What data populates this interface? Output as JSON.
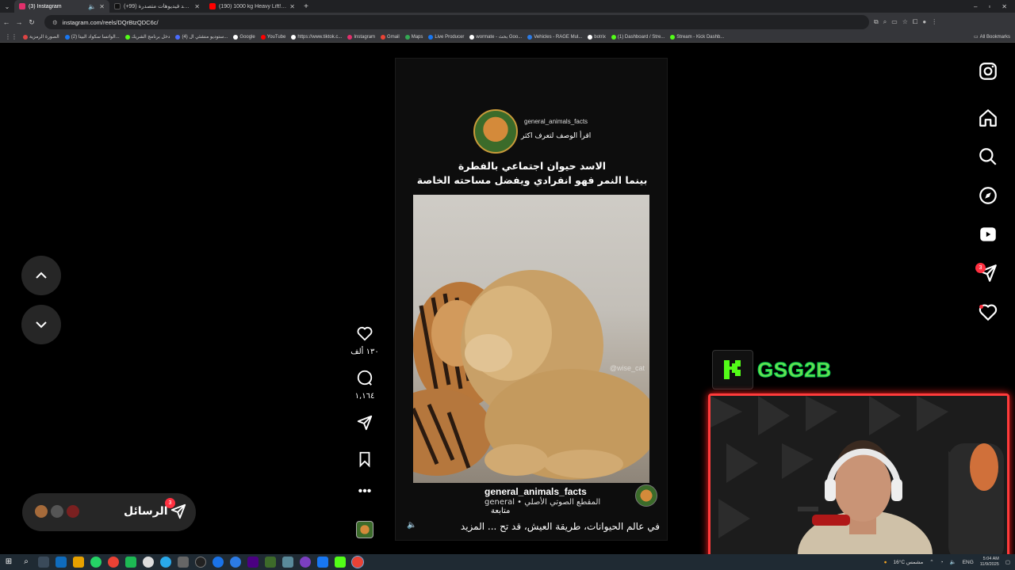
{
  "browser": {
    "tabs": [
      {
        "title": "(3) Instagram",
        "active": true,
        "color": "#e1306c"
      },
      {
        "title": "(+99) شاهد فيديوهات متصدرة",
        "active": false,
        "color": "#111"
      },
      {
        "title": "(190) 1000 kg Heavy Lift! U.S. M",
        "active": false,
        "color": "#ff0000"
      }
    ],
    "url": "instagram.com/reels/DQrBtzQDC6c/",
    "bookmarks": [
      {
        "label": "الصورة الرمزية",
        "color": "#d44"
      },
      {
        "label": "(2) الواتسا سكواد البيتا...",
        "color": "#1877f2"
      },
      {
        "label": "دخل برنامج الشريك",
        "color": "#53fc18"
      },
      {
        "label": "(4) ستوديو منشئي ال...",
        "color": "#4a6cff"
      },
      {
        "label": "Google",
        "color": "#fff"
      },
      {
        "label": "YouTube",
        "color": "#ff0000"
      },
      {
        "label": "https://www.tiktok.c...",
        "color": "#fff"
      },
      {
        "label": "Instagram",
        "color": "#e1306c"
      },
      {
        "label": "Gmail",
        "color": "#ea4335"
      },
      {
        "label": "Maps",
        "color": "#34a853"
      },
      {
        "label": "Live Producer",
        "color": "#1877f2"
      },
      {
        "label": "wormate - بحث Goo...",
        "color": "#fff"
      },
      {
        "label": "Vehicles - RAGE Mul...",
        "color": "#2c7be5"
      },
      {
        "label": "botrix",
        "color": "#fff"
      },
      {
        "label": "(1) Dashboard / Stre...",
        "color": "#53fc18"
      },
      {
        "label": "Stream - Kick Dashb...",
        "color": "#53fc18"
      }
    ],
    "all_bookmarks": "All Bookmarks"
  },
  "reel": {
    "username": "general_animals_facts",
    "subtitle": "اقرأ الوصف لتعرف اكثر",
    "caption_line1": "الاسد حيوان اجتماعي بالفطرة",
    "caption_line2": "بينما النمر فهو انفرادي ويفضل مساحته الخاصة",
    "watermark": "@wise_cat",
    "owner": "general_animals_facts",
    "audio": "general • المقطع الصوتي الأصلي",
    "follow": "متابعة",
    "description": "في عالم الحيوانات، طريقة العيش، قد تح ... المزيد"
  },
  "actions": {
    "likes": "١٣٠ ألف",
    "comments": "١,١٦٤"
  },
  "messages": {
    "label": "الرسائل",
    "badge": "3"
  },
  "nav": {
    "notifications_badge": "3"
  },
  "stream": {
    "channel": "GSG2B"
  },
  "taskbar": {
    "weather": "16°C مشمس",
    "lang": "ENG",
    "time": "5:04 AM",
    "date": "11/9/2025"
  }
}
